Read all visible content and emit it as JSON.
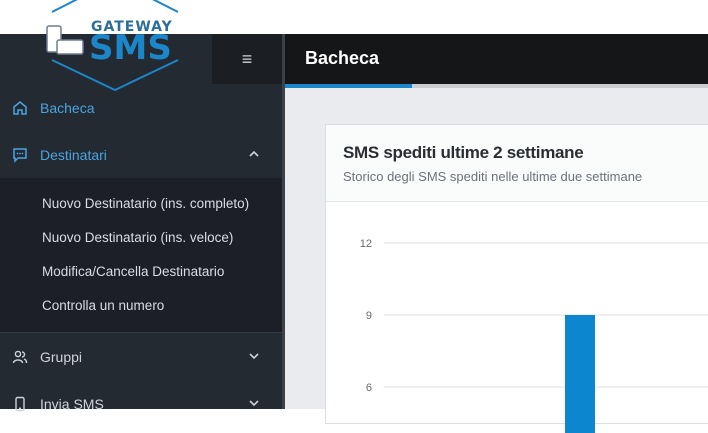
{
  "logo": {
    "gateway": "GATEWAY",
    "sms": "SMS"
  },
  "header": {
    "title": "Bacheca",
    "menu_icon": "hamburger-icon",
    "progress_percent": 30
  },
  "sidebar": {
    "items": [
      {
        "label": "Bacheca",
        "icon": "home-icon",
        "active": true
      },
      {
        "label": "Destinatari",
        "icon": "message-icon",
        "expanded": true,
        "children": [
          "Nuovo Destinatario (ins. completo)",
          "Nuovo Destinatario (ins. veloce)",
          "Modifica/Cancella Destinatario",
          "Controlla un numero"
        ]
      },
      {
        "label": "Gruppi",
        "icon": "users-icon"
      },
      {
        "label": "Invia SMS",
        "icon": "phone-icon"
      }
    ]
  },
  "card": {
    "title": "SMS spediti ultime 2 settimane",
    "subtitle": "Storico degli SMS spediti nelle ultime due settimane"
  },
  "chart_data": {
    "type": "bar",
    "ticks": [
      12,
      9,
      6
    ],
    "ylim": [
      0,
      12
    ],
    "values": [
      9
    ],
    "bar_color": "#0b86cf",
    "grid": true
  },
  "colors": {
    "accent": "#1b86c9",
    "sidebar": "#242a31",
    "header": "#141618"
  }
}
